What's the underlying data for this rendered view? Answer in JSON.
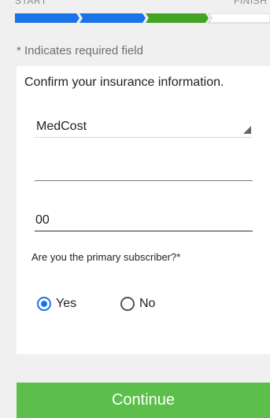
{
  "progress": {
    "start_label": "START",
    "finish_label": "FINISH"
  },
  "form": {
    "required_note": "* Indicates required field",
    "title": "Confirm your insurance information.",
    "insurance_select": {
      "value": "MedCost"
    },
    "field_2": {
      "value": "00"
    },
    "question": "Are you the primary subscriber?*",
    "radio_yes": {
      "label": "Yes",
      "selected": true
    },
    "radio_no": {
      "label": "No",
      "selected": false
    }
  },
  "continue_button": {
    "label": "Continue"
  },
  "colors": {
    "progress_blue": "#1a73e8",
    "progress_green": "#43a323",
    "radio_selected": "#1a73e8",
    "continue_green": "#5cbf4c"
  }
}
